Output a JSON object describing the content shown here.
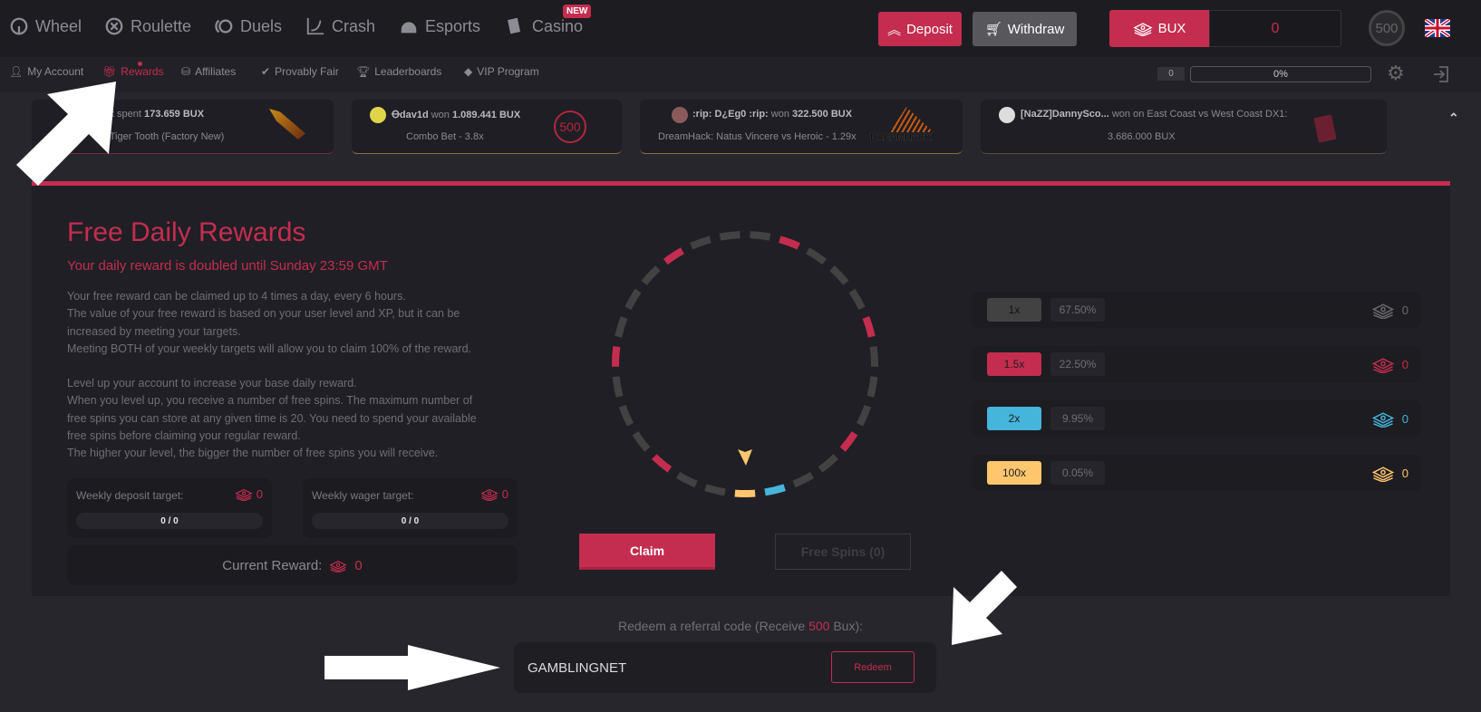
{
  "nav": {
    "items": [
      {
        "label": "Wheel",
        "icon": "wheel-icon"
      },
      {
        "label": "Roulette",
        "icon": "roulette-icon"
      },
      {
        "label": "Duels",
        "icon": "duels-icon"
      },
      {
        "label": "Crash",
        "icon": "crash-icon"
      },
      {
        "label": "Esports",
        "icon": "esports-icon"
      },
      {
        "label": "Casino",
        "icon": "casino-icon",
        "badge": "NEW"
      }
    ],
    "deposit": "Deposit",
    "withdraw": "Withdraw",
    "currency": "BUX",
    "balance": "0",
    "level_badge": "500"
  },
  "subnav": {
    "items": [
      {
        "label": "My Account"
      },
      {
        "label": "Rewards",
        "active": true
      },
      {
        "label": "Affiliates"
      },
      {
        "label": "Provably Fair"
      },
      {
        "label": "Leaderboards"
      },
      {
        "label": "VIP Program"
      }
    ],
    "level": "0",
    "xp_progress": "0%"
  },
  "ticker": [
    {
      "pre": "ck spent ",
      "amount": "173.659 BUX",
      "line2": "| Tiger Tooth (Factory New)"
    },
    {
      "user": "Ꝋdav1d",
      "pre": " won ",
      "amount": "1.089.441 BUX",
      "line2": "Combo Bet - 3.8x",
      "logo": "500"
    },
    {
      "user": ":rip: D¿Eg0 :rip:",
      "pre": " won ",
      "amount": "322.500 BUX",
      "line2": "DreamHack: Natus Vincere vs Heroic - 1.29x",
      "logo": "DREAMHACK"
    },
    {
      "user": "[NaZZ]DannySco...",
      "pre": " won on East Coast vs West Coast DX1:",
      "line2": "3.686.000 BUX"
    }
  ],
  "rewards": {
    "title": "Free Daily Rewards",
    "subtitle": "Your daily reward is doubled until Sunday 23:59 GMT",
    "para1": [
      "Your free reward can be claimed up to 4 times a day, every 6 hours.",
      "The value of your free reward is based on your user level and XP, but it can be increased by meeting your targets.",
      "Meeting BOTH of your weekly targets will allow you to claim 100% of the reward."
    ],
    "para2": [
      "Level up your account to increase your base daily reward.",
      "When you level up, you receive a number of free spins. The maximum number of free spins you can store at any given time is 20. You need to spend your available free spins before claiming your regular reward.",
      "The higher your level, the bigger the number of free spins you will receive."
    ],
    "deposit_target": {
      "label": "Weekly deposit target:",
      "value": "0",
      "progress": "0 / 0"
    },
    "wager_target": {
      "label": "Weekly wager target:",
      "value": "0",
      "progress": "0 / 0"
    },
    "current_reward_label": "Current Reward:",
    "current_reward": "0",
    "claim": "Claim",
    "free_spins": "Free Spins (0)",
    "multipliers": [
      {
        "label": "1x",
        "chance": "67.50%",
        "value": "0",
        "color": "#424242"
      },
      {
        "label": "1.5x",
        "chance": "22.50%",
        "value": "0",
        "color": "#c42d4f"
      },
      {
        "label": "2x",
        "chance": "9.95%",
        "value": "0",
        "color": "#45b5dc"
      },
      {
        "label": "100x",
        "chance": "0.05%",
        "value": "0",
        "color": "#ffc66e"
      }
    ],
    "wheel_segments": [
      "yellow",
      "gray",
      "gray",
      "red",
      "gray",
      "gray",
      "gray",
      "red",
      "gray",
      "gray",
      "gray",
      "red",
      "gray",
      "gray",
      "gray",
      "red",
      "gray",
      "gray",
      "gray",
      "red",
      "gray",
      "gray",
      "gray",
      "red",
      "gray",
      "gray",
      "blue"
    ]
  },
  "referral": {
    "label_pre": "Redeem a referral code (Receive ",
    "label_amount": "500",
    "label_post": " Bux):",
    "code": "GAMBLINGNET",
    "button": "Redeem"
  },
  "colors": {
    "accent": "#c42d4f",
    "gray": "#424242",
    "blue": "#45b5dc",
    "yellow": "#ffc66e"
  }
}
